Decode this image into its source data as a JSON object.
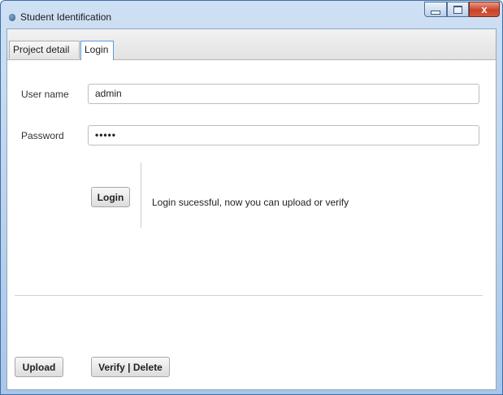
{
  "window": {
    "title": "Student Identification",
    "icon": "app-icon",
    "controls": {
      "minimize": "minimize-icon",
      "maximize": "maximize-icon",
      "close_label": "x"
    }
  },
  "tabs": [
    {
      "label": "Project detail",
      "active": false
    },
    {
      "label": "Login",
      "active": true
    }
  ],
  "form": {
    "username_label": "User name",
    "username_value": "admin",
    "password_label": "Password",
    "password_value": "•••••"
  },
  "login": {
    "button_label": "Login",
    "status_message": "Login sucessful, now you can upload or verify"
  },
  "actions": {
    "upload_label": "Upload",
    "verify_delete_label": "Verify | Delete"
  },
  "colors": {
    "title_bar": "#a9c6e8",
    "close_button": "#c84428",
    "active_tab_border": "#5b9bd5"
  }
}
